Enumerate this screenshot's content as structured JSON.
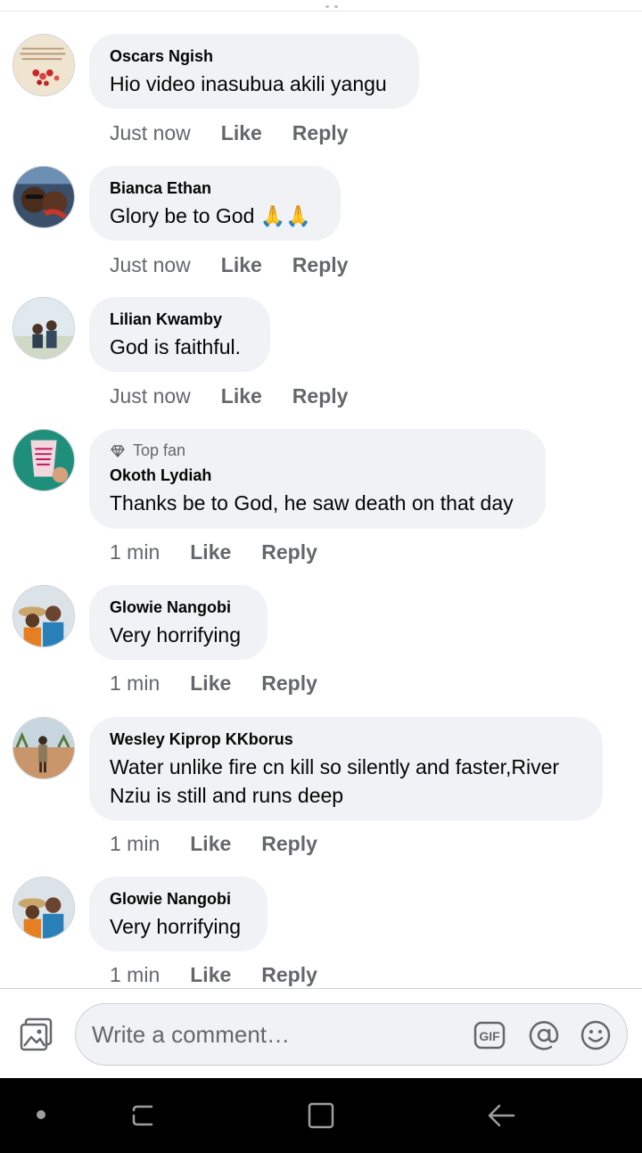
{
  "comments": [
    {
      "author": "Oscars Ngish",
      "badge": "",
      "text": "Hio video inasubua akili yangu",
      "time": "Just now",
      "like": "Like",
      "reply": "Reply"
    },
    {
      "author": "Bianca Ethan",
      "badge": "",
      "text": "Glory be to God 🙏🙏",
      "time": "Just now",
      "like": "Like",
      "reply": "Reply"
    },
    {
      "author": "Lilian Kwamby",
      "badge": "",
      "text": "God is faithful.",
      "time": "Just now",
      "like": "Like",
      "reply": "Reply"
    },
    {
      "author": "Okoth Lydiah",
      "badge": "Top fan",
      "text": "Thanks be to God, he saw death on that day",
      "time": "1 min",
      "like": "Like",
      "reply": "Reply"
    },
    {
      "author": "Glowie Nangobi",
      "badge": "",
      "text": "Very horrifying",
      "time": "1 min",
      "like": "Like",
      "reply": "Reply"
    },
    {
      "author": "Wesley Kiprop KKborus",
      "badge": "",
      "text": "Water unlike fire cn kill so silently and faster,River Nziu is still and runs deep",
      "time": "1 min",
      "like": "Like",
      "reply": "Reply"
    },
    {
      "author": "Glowie Nangobi",
      "badge": "",
      "text": "Very horrifying",
      "time": "1 min",
      "like": "Like",
      "reply": "Reply"
    }
  ],
  "composer": {
    "placeholder": "Write a comment…",
    "gif_label": "GIF",
    "icons": [
      "photo-icon",
      "gif-icon",
      "at-icon",
      "emoji-icon"
    ]
  },
  "navbar": {
    "icons": [
      "dot-icon",
      "recent-apps-icon",
      "home-icon",
      "back-icon"
    ]
  },
  "colors": {
    "bubble": "#f0f2f5",
    "secondary_text": "#65676b",
    "primary_text": "#050505",
    "navbar": "#000000"
  }
}
